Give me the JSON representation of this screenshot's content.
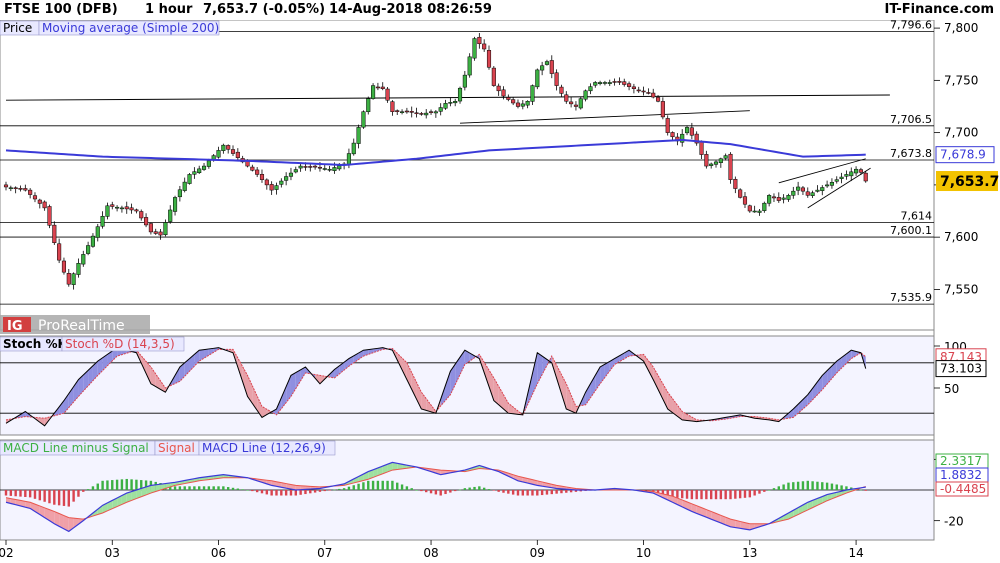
{
  "header": {
    "instrument": "FTSE 100 (DFB)",
    "timeframe": "1 hour",
    "quote": "7,653.7 (-0.05%)",
    "datetime": "14-Aug-2018 08:26:59",
    "brand": "IT-Finance.com"
  },
  "watermark": {
    "logo_text": "IG",
    "platform": "ProRealTime"
  },
  "colors": {
    "bull": "#3cb043",
    "bear": "#d9434f",
    "ma": "#3a3ad8",
    "stoch_k": "#000000",
    "stoch_d": "#d9434f",
    "macd_line": "#3a3ad8",
    "signal": "#e8564d",
    "panel_bg": "#f4f4ff",
    "current_price_bg": "#f2c200"
  },
  "chart_data": [
    {
      "type": "candlestick",
      "panel": "price",
      "legend": [
        "Price",
        "Moving average (Simple 200)"
      ],
      "x_tick_labels": [
        "02",
        "03",
        "06",
        "07",
        "08",
        "09",
        "10",
        "13",
        "14"
      ],
      "ylim": [
        7515,
        7802
      ],
      "y_ticks": [
        7550,
        7600,
        7650,
        7700,
        7750,
        7800
      ],
      "y_tick_labels": [
        "7,550",
        "7,600",
        "7,650",
        "7,700",
        "7,750",
        "7,800"
      ],
      "levels": [
        {
          "value": 7796.6,
          "label": "7,796.6"
        },
        {
          "value": 7706.5,
          "label": "7,706.5"
        },
        {
          "value": 7673.8,
          "label": "7,673.8"
        },
        {
          "value": 7614,
          "label": "7,614"
        },
        {
          "value": 7600.1,
          "label": "7,600.1"
        },
        {
          "value": 7535.9,
          "label": "7,535.9"
        }
      ],
      "ma_value": {
        "value": 7678.9,
        "label": "7,678.9"
      },
      "current_price": {
        "value": 7653.7,
        "label": "7,653.7"
      },
      "trendlines": [
        {
          "from": [
            0,
            7731
          ],
          "to": [
            183,
            7736
          ]
        },
        {
          "from": [
            94,
            7709
          ],
          "to": [
            154,
            7721
          ]
        },
        {
          "from": [
            160,
            7652
          ],
          "to": [
            178,
            7675
          ]
        },
        {
          "from": [
            166,
            7628
          ],
          "to": [
            179,
            7666
          ]
        }
      ],
      "ma_anchors": [
        [
          0,
          7683
        ],
        [
          20,
          7677
        ],
        [
          50,
          7673
        ],
        [
          70,
          7669
        ],
        [
          85,
          7675
        ],
        [
          100,
          7683
        ],
        [
          120,
          7688
        ],
        [
          140,
          7693
        ],
        [
          150,
          7689
        ],
        [
          165,
          7677
        ],
        [
          178,
          7678.9
        ]
      ],
      "close_anchors": [
        [
          0,
          7648
        ],
        [
          4,
          7645
        ],
        [
          8,
          7628
        ],
        [
          11,
          7578
        ],
        [
          13,
          7555
        ],
        [
          15,
          7575
        ],
        [
          17,
          7592
        ],
        [
          19,
          7610
        ],
        [
          21,
          7630
        ],
        [
          24,
          7628
        ],
        [
          27,
          7625
        ],
        [
          30,
          7605
        ],
        [
          32,
          7602
        ],
        [
          35,
          7638
        ],
        [
          38,
          7660
        ],
        [
          41,
          7668
        ],
        [
          45,
          7688
        ],
        [
          47,
          7680
        ],
        [
          49,
          7672
        ],
        [
          52,
          7660
        ],
        [
          55,
          7645
        ],
        [
          58,
          7658
        ],
        [
          61,
          7668
        ],
        [
          64,
          7667
        ],
        [
          67,
          7665
        ],
        [
          70,
          7670
        ],
        [
          72,
          7690
        ],
        [
          74,
          7720
        ],
        [
          76,
          7745
        ],
        [
          78,
          7742
        ],
        [
          80,
          7720
        ],
        [
          83,
          7720
        ],
        [
          86,
          7718
        ],
        [
          89,
          7720
        ],
        [
          91,
          7728
        ],
        [
          93,
          7730
        ],
        [
          95,
          7755
        ],
        [
          97,
          7790
        ],
        [
          99,
          7780
        ],
        [
          101,
          7745
        ],
        [
          103,
          7735
        ],
        [
          106,
          7725
        ],
        [
          108,
          7730
        ],
        [
          110,
          7760
        ],
        [
          112,
          7768
        ],
        [
          114,
          7745
        ],
        [
          116,
          7730
        ],
        [
          118,
          7725
        ],
        [
          120,
          7740
        ],
        [
          122,
          7748
        ],
        [
          124,
          7748
        ],
        [
          127,
          7748
        ],
        [
          130,
          7742
        ],
        [
          133,
          7738
        ],
        [
          135,
          7730
        ],
        [
          137,
          7700
        ],
        [
          139,
          7692
        ],
        [
          141,
          7705
        ],
        [
          143,
          7690
        ],
        [
          145,
          7668
        ],
        [
          147,
          7672
        ],
        [
          149,
          7678
        ],
        [
          150,
          7655
        ],
        [
          152,
          7638
        ],
        [
          154,
          7625
        ],
        [
          156,
          7625
        ],
        [
          158,
          7640
        ],
        [
          160,
          7635
        ],
        [
          162,
          7640
        ],
        [
          164,
          7648
        ],
        [
          166,
          7640
        ],
        [
          168,
          7645
        ],
        [
          170,
          7650
        ],
        [
          172,
          7655
        ],
        [
          174,
          7660
        ],
        [
          176,
          7665
        ],
        [
          177,
          7662
        ],
        [
          178,
          7653.7
        ]
      ]
    },
    {
      "type": "line",
      "panel": "stochastic",
      "legend": [
        "Stoch %K",
        "Stoch %D (14,3,5)"
      ],
      "ylim": [
        0,
        100
      ],
      "y_tick_labels": [
        "100",
        "50"
      ],
      "y_tick_values": [
        100,
        50
      ],
      "levels": [
        80,
        20
      ],
      "k_last": {
        "value": 73.103,
        "label": "73.103"
      },
      "d_last": {
        "value": 87.143,
        "label": "87.143"
      },
      "k_anchors": [
        [
          0,
          8
        ],
        [
          4,
          22
        ],
        [
          8,
          5
        ],
        [
          12,
          35
        ],
        [
          15,
          60
        ],
        [
          19,
          82
        ],
        [
          23,
          98
        ],
        [
          27,
          92
        ],
        [
          30,
          55
        ],
        [
          33,
          45
        ],
        [
          36,
          75
        ],
        [
          40,
          95
        ],
        [
          44,
          98
        ],
        [
          47,
          92
        ],
        [
          50,
          40
        ],
        [
          53,
          15
        ],
        [
          56,
          25
        ],
        [
          59,
          65
        ],
        [
          62,
          75
        ],
        [
          65,
          55
        ],
        [
          68,
          72
        ],
        [
          71,
          85
        ],
        [
          74,
          95
        ],
        [
          78,
          98
        ],
        [
          80,
          95
        ],
        [
          83,
          60
        ],
        [
          86,
          25
        ],
        [
          89,
          20
        ],
        [
          92,
          70
        ],
        [
          95,
          95
        ],
        [
          98,
          85
        ],
        [
          101,
          35
        ],
        [
          104,
          20
        ],
        [
          107,
          18
        ],
        [
          110,
          92
        ],
        [
          113,
          80
        ],
        [
          116,
          25
        ],
        [
          118,
          20
        ],
        [
          120,
          45
        ],
        [
          123,
          75
        ],
        [
          126,
          85
        ],
        [
          129,
          95
        ],
        [
          132,
          82
        ],
        [
          134,
          60
        ],
        [
          137,
          25
        ],
        [
          140,
          12
        ],
        [
          143,
          10
        ],
        [
          146,
          12
        ],
        [
          149,
          15
        ],
        [
          152,
          18
        ],
        [
          155,
          14
        ],
        [
          158,
          12
        ],
        [
          160,
          10
        ],
        [
          163,
          25
        ],
        [
          166,
          42
        ],
        [
          169,
          65
        ],
        [
          172,
          82
        ],
        [
          175,
          95
        ],
        [
          177,
          92
        ],
        [
          178,
          73.1
        ]
      ],
      "d_anchors": [
        [
          0,
          12
        ],
        [
          4,
          16
        ],
        [
          8,
          14
        ],
        [
          12,
          20
        ],
        [
          15,
          40
        ],
        [
          19,
          65
        ],
        [
          23,
          88
        ],
        [
          27,
          95
        ],
        [
          30,
          75
        ],
        [
          33,
          50
        ],
        [
          36,
          58
        ],
        [
          40,
          82
        ],
        [
          44,
          96
        ],
        [
          47,
          96
        ],
        [
          50,
          65
        ],
        [
          53,
          28
        ],
        [
          56,
          18
        ],
        [
          59,
          40
        ],
        [
          62,
          68
        ],
        [
          65,
          65
        ],
        [
          68,
          62
        ],
        [
          71,
          76
        ],
        [
          74,
          88
        ],
        [
          78,
          96
        ],
        [
          80,
          97
        ],
        [
          83,
          80
        ],
        [
          86,
          45
        ],
        [
          89,
          22
        ],
        [
          92,
          42
        ],
        [
          95,
          78
        ],
        [
          98,
          90
        ],
        [
          101,
          62
        ],
        [
          104,
          32
        ],
        [
          107,
          18
        ],
        [
          110,
          55
        ],
        [
          113,
          88
        ],
        [
          116,
          55
        ],
        [
          118,
          28
        ],
        [
          120,
          30
        ],
        [
          123,
          55
        ],
        [
          126,
          78
        ],
        [
          129,
          88
        ],
        [
          132,
          90
        ],
        [
          134,
          75
        ],
        [
          137,
          45
        ],
        [
          140,
          22
        ],
        [
          143,
          12
        ],
        [
          146,
          11
        ],
        [
          149,
          13
        ],
        [
          152,
          16
        ],
        [
          155,
          16
        ],
        [
          158,
          14
        ],
        [
          160,
          12
        ],
        [
          163,
          15
        ],
        [
          166,
          30
        ],
        [
          169,
          48
        ],
        [
          172,
          68
        ],
        [
          175,
          85
        ],
        [
          177,
          92
        ],
        [
          178,
          87.1
        ]
      ]
    },
    {
      "type": "line",
      "panel": "macd",
      "legend": [
        "MACD Line minus Signal",
        "Signal",
        "MACD Line (12,26,9)"
      ],
      "ylim": [
        -30,
        30
      ],
      "y_tick_labels": [
        "20",
        "-20"
      ],
      "y_tick_values": [
        20,
        -20
      ],
      "macd_last": {
        "value": 1.8832,
        "label": "1.8832"
      },
      "signal_last": {
        "value": 2.3317,
        "label": "2.3317"
      },
      "hist_last": {
        "value": -0.4485,
        "label": "-0.4485"
      },
      "macd_anchors": [
        [
          0,
          -8
        ],
        [
          5,
          -12
        ],
        [
          10,
          -22
        ],
        [
          13,
          -27
        ],
        [
          16,
          -20
        ],
        [
          20,
          -10
        ],
        [
          25,
          -2
        ],
        [
          30,
          3
        ],
        [
          35,
          5
        ],
        [
          40,
          8
        ],
        [
          45,
          10
        ],
        [
          50,
          8
        ],
        [
          55,
          3
        ],
        [
          60,
          0
        ],
        [
          65,
          1
        ],
        [
          70,
          4
        ],
        [
          75,
          12
        ],
        [
          80,
          18
        ],
        [
          85,
          15
        ],
        [
          90,
          10
        ],
        [
          95,
          13
        ],
        [
          98,
          16
        ],
        [
          102,
          12
        ],
        [
          106,
          6
        ],
        [
          110,
          3
        ],
        [
          114,
          1
        ],
        [
          118,
          0
        ],
        [
          122,
          0
        ],
        [
          126,
          1
        ],
        [
          130,
          0
        ],
        [
          134,
          -2
        ],
        [
          138,
          -8
        ],
        [
          142,
          -14
        ],
        [
          146,
          -19
        ],
        [
          150,
          -24
        ],
        [
          154,
          -26
        ],
        [
          158,
          -22
        ],
        [
          162,
          -15
        ],
        [
          166,
          -8
        ],
        [
          170,
          -3
        ],
        [
          174,
          0
        ],
        [
          178,
          1.88
        ]
      ],
      "signal_anchors": [
        [
          0,
          -5
        ],
        [
          5,
          -8
        ],
        [
          10,
          -14
        ],
        [
          13,
          -18
        ],
        [
          16,
          -19
        ],
        [
          20,
          -15
        ],
        [
          25,
          -8
        ],
        [
          30,
          -2
        ],
        [
          35,
          3
        ],
        [
          40,
          6
        ],
        [
          45,
          8
        ],
        [
          50,
          8
        ],
        [
          55,
          6
        ],
        [
          60,
          3
        ],
        [
          65,
          2
        ],
        [
          70,
          3
        ],
        [
          75,
          7
        ],
        [
          80,
          13
        ],
        [
          85,
          15
        ],
        [
          90,
          13
        ],
        [
          95,
          12
        ],
        [
          98,
          14
        ],
        [
          102,
          13
        ],
        [
          106,
          9
        ],
        [
          110,
          6
        ],
        [
          114,
          3
        ],
        [
          118,
          1
        ],
        [
          122,
          0
        ],
        [
          126,
          0
        ],
        [
          130,
          0
        ],
        [
          134,
          -1
        ],
        [
          138,
          -4
        ],
        [
          142,
          -9
        ],
        [
          146,
          -14
        ],
        [
          150,
          -19
        ],
        [
          154,
          -22
        ],
        [
          158,
          -22
        ],
        [
          162,
          -19
        ],
        [
          166,
          -13
        ],
        [
          170,
          -7
        ],
        [
          174,
          -2
        ],
        [
          178,
          2.33
        ]
      ]
    }
  ]
}
